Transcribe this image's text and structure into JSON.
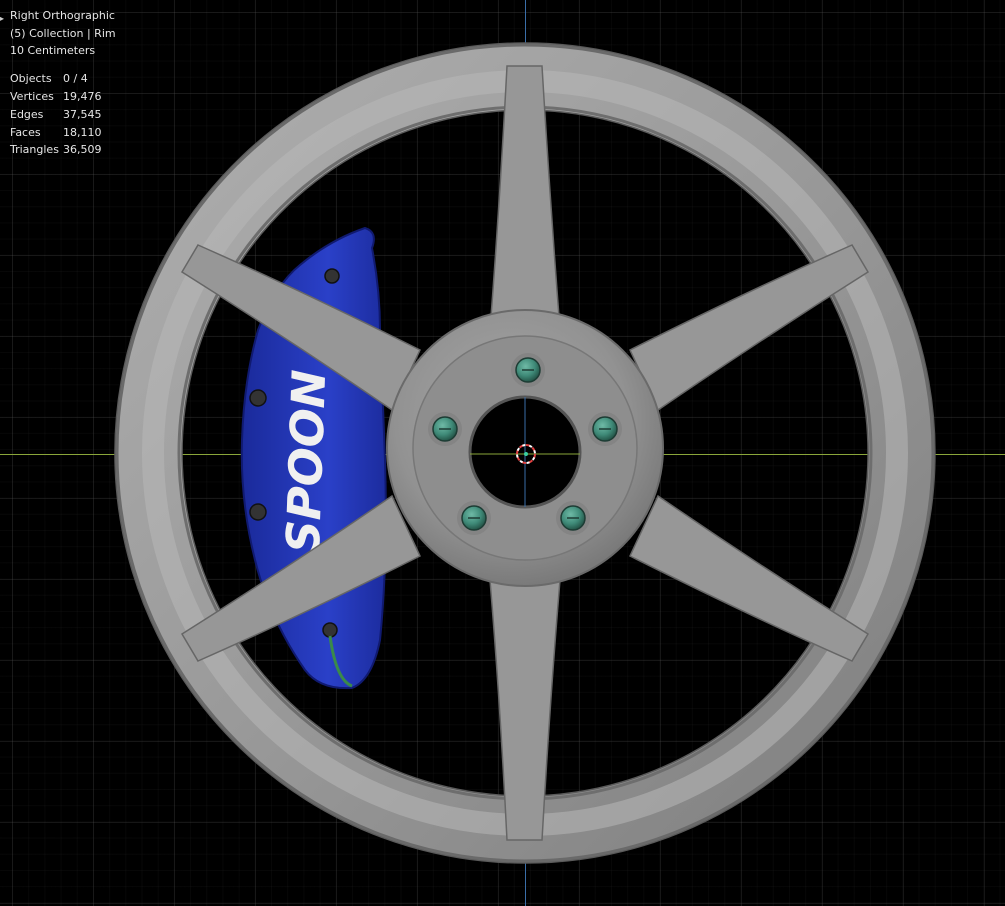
{
  "viewport": {
    "view_name": "Right Orthographic",
    "collection_info": "(5) Collection | Rim",
    "grid_scale": "10 Centimeters"
  },
  "statistics": [
    {
      "label": "Objects",
      "value": "0 / 4"
    },
    {
      "label": "Vertices",
      "value": "19,476"
    },
    {
      "label": "Edges",
      "value": "37,545"
    },
    {
      "label": "Faces",
      "value": "18,110"
    },
    {
      "label": "Triangles",
      "value": "36,509"
    }
  ],
  "scene": {
    "caliper_text": "SPOON",
    "colors": {
      "rim": "#9a9a9a",
      "caliper": "#2233b0",
      "lug_nut": "#3f8a78",
      "x_axis": "#8aa63a",
      "z_axis": "#3a6ea8",
      "cursor": "#e04040",
      "grid_background": "#000000"
    }
  }
}
